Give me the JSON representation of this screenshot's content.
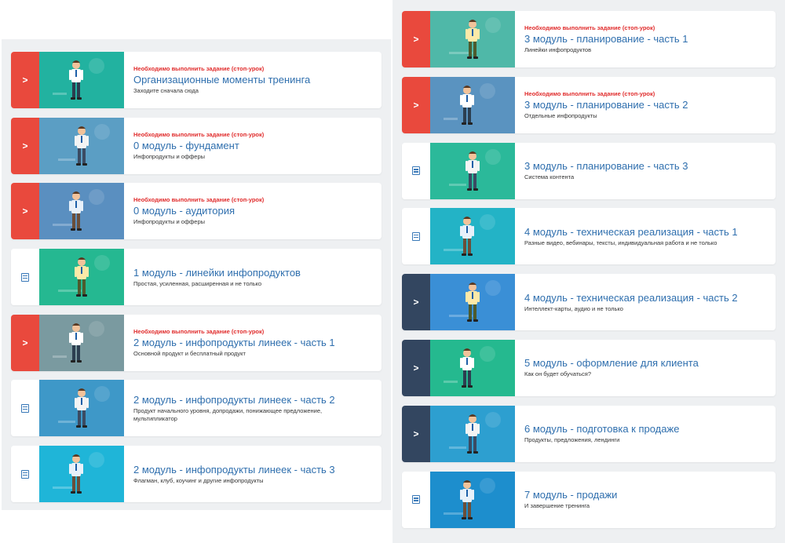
{
  "colors": {
    "panel_bg": "#eef0f2",
    "locked_accent": "#e9493d",
    "available_accent": "#334660",
    "title_link": "#2f6fae",
    "warning_text": "#e02b2b",
    "doc_icon": "#3a79b8"
  },
  "left_column": [
    {
      "status": "locked",
      "lead_icon": "chevron-right-icon",
      "warning": "Необходимо выполнить задание (стоп-урок)",
      "title": "Организационные моменты тренинга",
      "subtitle": "Заходите сначала сюда",
      "thumb_bg": "#22b2a0",
      "thumb_scene": "man-standing-holding-box"
    },
    {
      "status": "locked",
      "lead_icon": "chevron-right-icon",
      "warning": "Необходимо выполнить задание (стоп-урок)",
      "title": "0 модуль - фундамент",
      "subtitle": "Инфопродукты и офферы",
      "thumb_bg": "#5b9ec4",
      "thumb_scene": "man-at-desk-with-laptop"
    },
    {
      "status": "locked",
      "lead_icon": "chevron-right-icon",
      "warning": "Необходимо выполнить задание (стоп-урок)",
      "title": "0 модуль - аудитория",
      "subtitle": "Инфопродукты и офферы",
      "thumb_bg": "#5a8fc0",
      "thumb_scene": "man-thinking-at-desk"
    },
    {
      "status": "open",
      "lead_icon": "document-icon",
      "warning": "",
      "title": "1 модуль - линейки инфопродуктов",
      "subtitle": "Простая, усиленная, расширенная и не только",
      "thumb_bg": "#25b891",
      "thumb_scene": "man-with-chart-board"
    },
    {
      "status": "locked",
      "lead_icon": "chevron-right-icon",
      "warning": "Необходимо выполнить задание (стоп-урок)",
      "title": "2 модуль - инфопродукты линеек - часть 1",
      "subtitle": "Основной продукт и бесплатный продукт",
      "thumb_bg": "#7a9aa0",
      "thumb_scene": "man-kneeling-with-lightbulb"
    },
    {
      "status": "open",
      "lead_icon": "document-icon",
      "warning": "",
      "title": "2 модуль - инфопродукты линеек - часть 2",
      "subtitle": "Продукт начального уровня, допродажи, понижающее предложение, мультипликатор",
      "thumb_bg": "#3e98c8",
      "thumb_scene": "man-pointing-with-heart"
    },
    {
      "status": "open",
      "lead_icon": "document-icon",
      "warning": "",
      "title": "2 модуль - инфопродукты линеек - часть 3",
      "subtitle": "Флагман, клуб, коучинг и другие инфопродукты",
      "thumb_bg": "#1fb5d8",
      "thumb_scene": "man-running-with-bag"
    }
  ],
  "right_column": [
    {
      "status": "locked",
      "lead_icon": "chevron-right-icon",
      "warning": "Необходимо выполнить задание (стоп-урок)",
      "title": "3 модуль - планирование - часть 1",
      "subtitle": "Линейки инфопродуктов",
      "thumb_bg": "#4fb8a8",
      "thumb_scene": "man-in-deck-chair-with-laptop"
    },
    {
      "status": "locked",
      "lead_icon": "chevron-right-icon",
      "warning": "Необходимо выполнить задание (стоп-урок)",
      "title": "3 модуль - планирование - часть 2",
      "subtitle": "Отдельные инфопродукты",
      "thumb_bg": "#5a93c0",
      "thumb_scene": "man-standing-with-tablet"
    },
    {
      "status": "open",
      "lead_icon": "document-icon",
      "warning": "",
      "title": "3 модуль - планирование - часть 3",
      "subtitle": "Система контента",
      "thumb_bg": "#2bb99a",
      "thumb_scene": "man-on-ladder"
    },
    {
      "status": "open",
      "lead_icon": "document-icon",
      "warning": "",
      "title": "4 модуль - техническая реализация - часть 1",
      "subtitle": "Разные видео, вебинары, тексты, индивидуальная работа и не только",
      "thumb_bg": "#23b3c6",
      "thumb_scene": "man-with-phone"
    },
    {
      "status": "available",
      "lead_icon": "chevron-right-icon",
      "warning": "",
      "title": "4 модуль - техническая реализация - часть 2",
      "subtitle": "Интеллект-карты, аудио и не только",
      "thumb_bg": "#3a8fd6",
      "thumb_scene": "woman-flying-on-cloud"
    },
    {
      "status": "available",
      "lead_icon": "chevron-right-icon",
      "warning": "",
      "title": "5 модуль - оформление для клиента",
      "subtitle": "Как он будет обучаться?",
      "thumb_bg": "#25b98f",
      "thumb_scene": "two-men-at-whiteboard"
    },
    {
      "status": "available",
      "lead_icon": "chevron-right-icon",
      "warning": "",
      "title": "6 модуль - подготовка к продаже",
      "subtitle": "Продукты, предложения, лендинги",
      "thumb_bg": "#2d9fd0",
      "thumb_scene": "man-at-table-with-bottle"
    },
    {
      "status": "open",
      "lead_icon": "document-icon",
      "warning": "",
      "title": "7 модуль - продажи",
      "subtitle": "И завершение тренинга",
      "thumb_bg": "#1d8ecd",
      "thumb_scene": "people-riding-rocket"
    }
  ]
}
